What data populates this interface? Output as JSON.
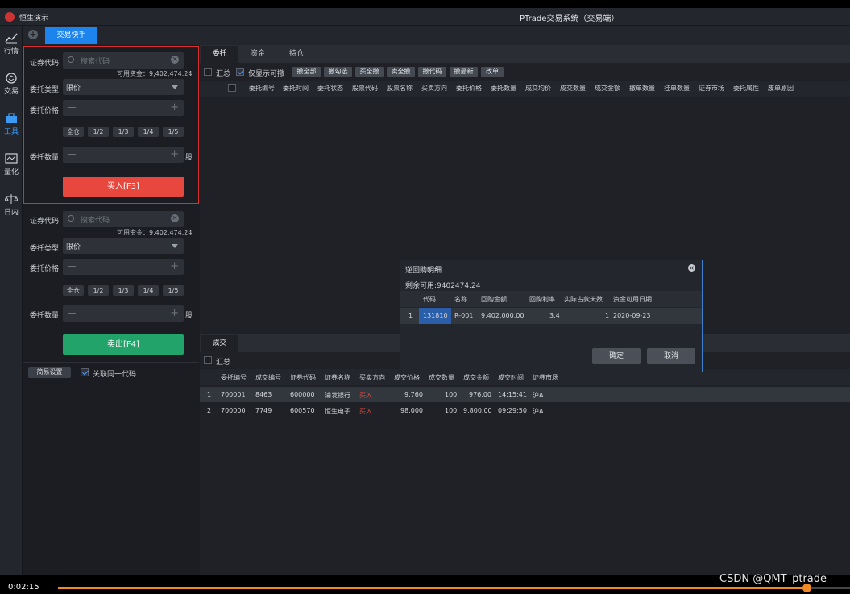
{
  "window": {
    "app_name": "恒生演示",
    "title": "PTrade交易系统（交易端）"
  },
  "nav": [
    {
      "label": "行情"
    },
    {
      "label": "交易"
    },
    {
      "label": "工具"
    },
    {
      "label": "量化"
    },
    {
      "label": "日内"
    }
  ],
  "tabs": {
    "quick": "交易快手"
  },
  "buy": {
    "code_label": "证券代码",
    "code_placeholder": "搜索代码",
    "avail": "可用资金：9,402,474.24",
    "type_label": "委托类型",
    "type_value": "限价",
    "price_label": "委托价格",
    "fracs": [
      "全仓",
      "1/2",
      "1/3",
      "1/4",
      "1/5"
    ],
    "qty_label": "委托数量",
    "unit": "股",
    "button": "买入[F3]"
  },
  "sell": {
    "code_label": "证券代码",
    "code_placeholder": "搜索代码",
    "avail": "可用资金：9,402,474.24",
    "type_label": "委托类型",
    "type_value": "限价",
    "price_label": "委托价格",
    "fracs": [
      "全仓",
      "1/2",
      "1/3",
      "1/4",
      "1/5"
    ],
    "qty_label": "委托数量",
    "unit": "股",
    "button": "卖出[F4]"
  },
  "footer": {
    "simple_settings": "简易设置",
    "link_code": "关联同一代码"
  },
  "orders": {
    "tabs": [
      "委托",
      "资金",
      "持仓"
    ],
    "summary_label": "汇总",
    "only_cancelable": "仅显示可撤",
    "buttons": [
      "撤全部",
      "撤勾选",
      "买全撤",
      "卖全撤",
      "撤代码",
      "撤最新",
      "改单"
    ],
    "headers": [
      "委托编号",
      "委托时间",
      "委托状态",
      "股票代码",
      "股票名称",
      "买卖方向",
      "委托价格",
      "委托数量",
      "成交均价",
      "成交数量",
      "成交金额",
      "撤单数量",
      "挂单数量",
      "证券市场",
      "委托属性",
      "废单原因"
    ]
  },
  "trades": {
    "tab": "成交",
    "summary_label": "汇总",
    "headers": [
      "委托编号",
      "成交编号",
      "证券代码",
      "证券名称",
      "买卖方向",
      "成交价格",
      "成交数量",
      "成交金额",
      "成交时间",
      "证券市场"
    ],
    "rows": [
      {
        "idx": "1",
        "order_no": "700001",
        "deal_no": "8463",
        "code": "600000",
        "name": "浦发银行",
        "side": "买入",
        "price": "9.760",
        "qty": "100",
        "amount": "976.00",
        "time": "14:15:41",
        "market": "沪A"
      },
      {
        "idx": "2",
        "order_no": "700000",
        "deal_no": "7749",
        "code": "600570",
        "name": "恒生电子",
        "side": "买入",
        "price": "98.000",
        "qty": "100",
        "amount": "9,800.00",
        "time": "09:29:50",
        "market": "沪A"
      }
    ]
  },
  "dialog": {
    "title": "逆回购明细",
    "remaining": "剩余可用:9402474.24",
    "headers": [
      "代码",
      "名称",
      "回购金额",
      "回购利率",
      "实际占款天数",
      "资金可用日期"
    ],
    "row": {
      "idx": "1",
      "code": "131810",
      "name": "R-001",
      "amount": "9,402,000.00",
      "rate": "3.4",
      "days": "1",
      "date": "2020-09-23"
    },
    "confirm": "确定",
    "cancel": "取消"
  },
  "player": {
    "time": "0:02:15",
    "progress": 0.946
  },
  "watermark": "CSDN @QMT_ptrade",
  "colors": {
    "accent": "#1c84ec",
    "buy": "#e8473d",
    "sell": "#22a36a",
    "border_red": "#d9302a",
    "side_red": "#e8473d",
    "dialog_border": "#3d7fd0",
    "progress": "#f08a24"
  }
}
